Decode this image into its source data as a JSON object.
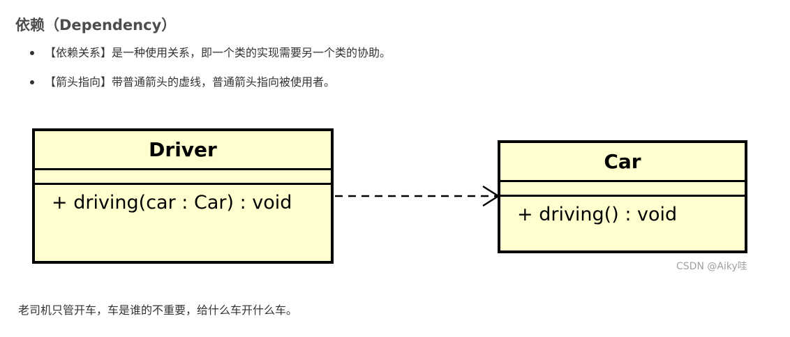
{
  "heading": "依赖（Dependency）",
  "bullets": [
    "【依赖关系】是一种使用关系，即一个类的实现需要另一个类的协助。",
    "【箭头指向】带普通箭头的虚线，普通箭头指向被使用者。"
  ],
  "diagram": {
    "driver": {
      "name": "Driver",
      "method": "+ driving(car : Car) : void"
    },
    "car": {
      "name": "Car",
      "method": "+ driving() : void"
    },
    "colors": {
      "class_fill": "#fefece",
      "class_border": "#000000"
    }
  },
  "watermark": "CSDN @Aiky哇",
  "note": "老司机只管开车，车是谁的不重要，给什么车开什么车。"
}
